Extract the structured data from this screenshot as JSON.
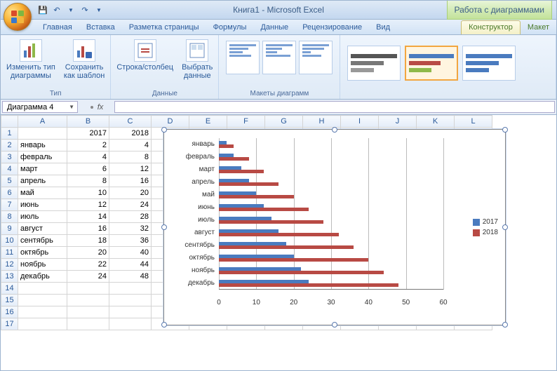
{
  "window": {
    "title": "Книга1 - Microsoft Excel",
    "context_tab": "Работа с диаграммами"
  },
  "qat": {
    "save": "💾",
    "undo": "↶",
    "redo": "↷"
  },
  "tabs": {
    "items": [
      "Главная",
      "Вставка",
      "Разметка страницы",
      "Формулы",
      "Данные",
      "Рецензирование",
      "Вид"
    ],
    "context": [
      "Конструктор",
      "Макет"
    ],
    "active": "Конструктор"
  },
  "ribbon": {
    "type_group": {
      "change_type": "Изменить тип\nдиаграммы",
      "save_template": "Сохранить\nкак шаблон",
      "label": "Тип"
    },
    "data_group": {
      "switch": "Строка/столбец",
      "select": "Выбрать\nданные",
      "label": "Данные"
    },
    "layouts_group": {
      "label": "Макеты диаграмм"
    }
  },
  "namebox": {
    "value": "Диаграмма 4",
    "fx": "fx"
  },
  "columns": [
    "A",
    "B",
    "C",
    "D",
    "E",
    "F",
    "G",
    "H",
    "I",
    "J",
    "K",
    "L"
  ],
  "rows": 17,
  "data": {
    "B1": 2017,
    "C1": 2018,
    "A2": "январь",
    "B2": 2,
    "C2": 4,
    "A3": "февраль",
    "B3": 4,
    "C3": 8,
    "A4": "март",
    "B4": 6,
    "C4": 12,
    "A5": "апрель",
    "B5": 8,
    "C5": 16,
    "A6": "май",
    "B6": 10,
    "C6": 20,
    "A7": "июнь",
    "B7": 12,
    "C7": 24,
    "A8": "июль",
    "B8": 14,
    "C8": 28,
    "A9": "август",
    "B9": 16,
    "C9": 32,
    "A10": "сентябрь",
    "B10": 18,
    "C10": 36,
    "A11": "октябрь",
    "B11": 20,
    "C11": 40,
    "A12": "ноябрь",
    "B12": 22,
    "C12": 44,
    "A13": "декабрь",
    "B13": 24,
    "C13": 48
  },
  "chart_data": {
    "type": "bar",
    "orientation": "horizontal",
    "categories": [
      "январь",
      "февраль",
      "март",
      "апрель",
      "май",
      "июнь",
      "июль",
      "август",
      "сентябрь",
      "октябрь",
      "ноябрь",
      "декабрь"
    ],
    "series": [
      {
        "name": "2017",
        "color": "#4a7bbf",
        "values": [
          2,
          4,
          6,
          8,
          10,
          12,
          14,
          16,
          18,
          20,
          22,
          24
        ]
      },
      {
        "name": "2018",
        "color": "#b84a44",
        "values": [
          4,
          8,
          12,
          16,
          20,
          24,
          28,
          32,
          36,
          40,
          44,
          48
        ]
      }
    ],
    "x_ticks": [
      0,
      10,
      20,
      30,
      40,
      50,
      60
    ],
    "xlim": [
      0,
      60
    ],
    "title": "",
    "xlabel": "",
    "ylabel": "",
    "legend_position": "right"
  }
}
